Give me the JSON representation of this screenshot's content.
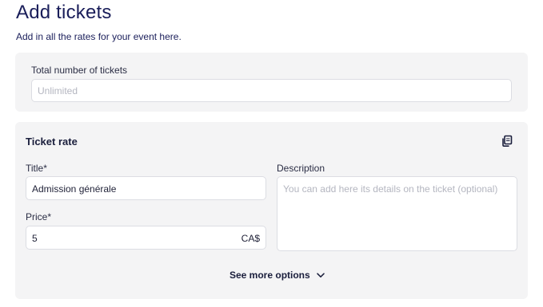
{
  "header": {
    "title": "Add tickets",
    "subtitle": "Add in all the rates for your event here."
  },
  "total": {
    "label": "Total number of tickets",
    "placeholder": "Unlimited"
  },
  "rate": {
    "section_title": "Ticket rate",
    "copy_icon": "copy-icon",
    "title_label": "Title*",
    "title_value": "Admission générale",
    "price_label": "Price*",
    "price_value": "5",
    "currency": "CA$",
    "description_label": "Description",
    "description_placeholder": "You can add here its details on the ticket (optional)",
    "more_options": "See more options",
    "more_icon": "chevron-down-icon"
  },
  "colors": {
    "text_dark": "#1a1e5a",
    "card_bg": "#f4f4f5",
    "placeholder": "#b4b6c0"
  }
}
